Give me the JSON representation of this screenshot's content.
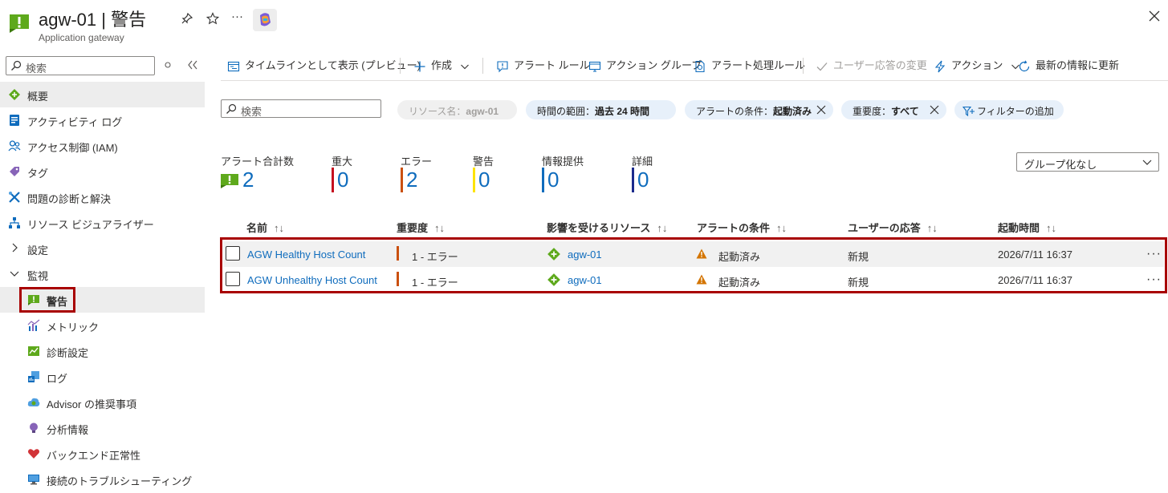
{
  "header": {
    "title": "agw-01 | 警告",
    "subtitle": "Application gateway",
    "more": "···"
  },
  "sidebar": {
    "search_placeholder": "検索",
    "items": [
      {
        "label": "概要"
      },
      {
        "label": "アクティビティ ログ"
      },
      {
        "label": "アクセス制御 (IAM)"
      },
      {
        "label": "タグ"
      },
      {
        "label": "問題の診断と解決"
      },
      {
        "label": "リソース ビジュアライザー"
      },
      {
        "label": "設定"
      },
      {
        "label": "監視"
      },
      {
        "label": "警告"
      },
      {
        "label": "メトリック"
      },
      {
        "label": "診断設定"
      },
      {
        "label": "ログ"
      },
      {
        "label": "Advisor の推奨事項"
      },
      {
        "label": "分析情報"
      },
      {
        "label": "バックエンド正常性"
      },
      {
        "label": "接続のトラブルシューティング"
      }
    ]
  },
  "toolbar": {
    "timeline": "タイムラインとして表示 (プレビュー)",
    "create": "作成",
    "alert_rules": "アラート ルール",
    "action_groups": "アクション グループ",
    "processing_rules": "アラート処理ルール",
    "change_user_response": "ユーザー応答の変更",
    "actions": "アクション",
    "refresh": "最新の情報に更新"
  },
  "filters": {
    "search_placeholder": "検索",
    "resource_label": "リソース名：",
    "resource_value": "agw-01",
    "time_label": "時間の範囲：",
    "time_value": "過去 24 時間",
    "condition_label": "アラートの条件：",
    "condition_value": "起動済み",
    "severity_label": "重要度：",
    "severity_value": "すべて",
    "add_filter": "フィルターの追加"
  },
  "summary": {
    "total_label": "アラート合計数",
    "total": "2",
    "critical_label": "重大",
    "critical": "0",
    "error_label": "エラー",
    "error": "2",
    "warning_label": "警告",
    "warning": "0",
    "info_label": "情報提供",
    "info": "0",
    "verbose_label": "詳細",
    "verbose": "0",
    "colors": {
      "critical": "#c50f1f",
      "error": "#ca5010",
      "warning": "#fde300",
      "info": "#0f6cbd",
      "verbose": "#1b2a8c"
    }
  },
  "grouping": {
    "value": "グループ化なし"
  },
  "table": {
    "sort_symbol": "↑↓",
    "columns": {
      "name": "名前",
      "severity": "重要度",
      "resource": "影響を受けるリソース",
      "condition": "アラートの条件",
      "response": "ユーザーの応答",
      "fired": "起動時間"
    },
    "rows": [
      {
        "name": "AGW Healthy Host Count",
        "severity": "1 - エラー",
        "resource": "agw-01",
        "condition": "起動済み",
        "response": "新規",
        "fired": "2026/7/11 16:37",
        "more": "···"
      },
      {
        "name": "AGW Unhealthy Host Count",
        "severity": "1 - エラー",
        "resource": "agw-01",
        "condition": "起動済み",
        "response": "新規",
        "fired": "2026/7/11 16:37",
        "more": "···"
      }
    ]
  }
}
